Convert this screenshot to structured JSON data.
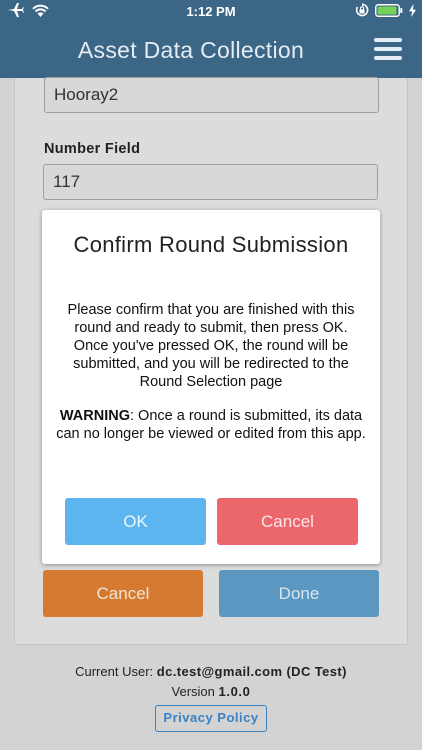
{
  "status_bar": {
    "time": "1:12 PM",
    "icons": [
      "airplane-icon",
      "wifi-icon",
      "orientation-lock-icon",
      "battery-icon",
      "charging-bolt-icon"
    ],
    "battery_level": 0.8
  },
  "header": {
    "title": "Asset Data Collection",
    "menu_icon": "hamburger-menu-icon"
  },
  "form": {
    "text_field_value": "Hooray2",
    "number_field_label": "Number Field",
    "number_field_value": "117",
    "cancel_label": "Cancel",
    "done_label": "Done"
  },
  "modal": {
    "title": "Confirm Round Submission",
    "body": "Please confirm that you are finished with this round and ready to submit, then press OK. Once you've pressed OK, the round will be submitted, and you will be redirected to the Round Selection page",
    "warning_label": "WARNING",
    "warning_text": ": Once a round is submitted, its data can no longer be viewed or edited from this app.",
    "ok_label": "OK",
    "cancel_label": "Cancel"
  },
  "footer": {
    "current_user_label": "Current User:",
    "current_user_value": "dc.test@gmail.com (DC Test)",
    "version_label": "Version",
    "version_value": "1.0.0",
    "privacy_label": "Privacy Policy"
  },
  "colors": {
    "header_bg": "#3c6685",
    "page_bg": "#d3d3d3",
    "ok_button": "#5db5f0",
    "modal_cancel_button": "#ec676b",
    "form_cancel_button": "#d47a31",
    "done_button": "#5b97c1",
    "privacy_border": "#3a82c2"
  }
}
